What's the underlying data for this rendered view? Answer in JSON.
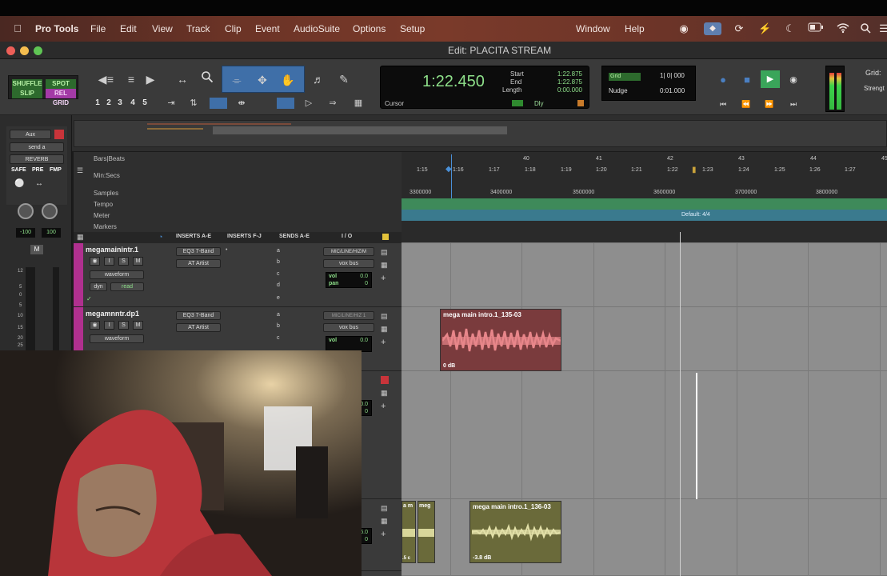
{
  "menubar": {
    "app_name": "Pro Tools",
    "items": [
      "File",
      "Edit",
      "View",
      "Track",
      "Clip",
      "Event",
      "AudioSuite",
      "Options",
      "Setup"
    ],
    "right_items": [
      "Window",
      "Help"
    ],
    "status_icons": [
      "apple-icon",
      "accessibility-icon",
      "vpn-icon",
      "sync-icon",
      "bolt-icon",
      "moon-icon",
      "battery-icon",
      "wifi-icon",
      "search-icon",
      "control-center-icon"
    ]
  },
  "window": {
    "title": "Edit: PLACITA STREAM"
  },
  "toolbar": {
    "modes": [
      "SHUFFLE",
      "SPOT",
      "SLIP",
      "REL GRID"
    ],
    "zoom_presets": [
      "1",
      "2",
      "3",
      "4",
      "5"
    ],
    "counter": {
      "main": "1:22.450",
      "start_label": "Start",
      "start": "1:22.875",
      "end_label": "End",
      "end": "1:22.875",
      "length_label": "Length",
      "length": "0:00.000",
      "cursor_label": "Cursor",
      "dly_label": "Dly"
    },
    "grid": {
      "label": "Grid",
      "value": "1| 0| 000",
      "nudge_label": "Nudge",
      "nudge_value": "0:01.000"
    },
    "grid_right_label": "Grid:",
    "strength_label": "Strengt"
  },
  "strip": {
    "aux_label": "Aux",
    "send_label": "send a",
    "reverb_label": "REVERB",
    "safe": "SAFE",
    "pre": "PRE",
    "fmp": "FMP",
    "pan_left": "-100",
    "pan_right": "100",
    "m": "M",
    "scale": [
      "12",
      "5",
      "0",
      "5",
      "10",
      "15",
      "20",
      "25"
    ]
  },
  "rulers": {
    "labels": [
      "Bars|Beats",
      "Min:Secs",
      "Samples",
      "Tempo",
      "Meter",
      "Markers"
    ],
    "bars": [
      "40",
      "41",
      "42",
      "43",
      "44",
      "45"
    ],
    "minsecs": [
      "1:15",
      "1:16",
      "1:17",
      "1:18",
      "1:19",
      "1:20",
      "1:21",
      "1:22",
      "1:23",
      "1:24",
      "1:25",
      "1:26",
      "1:27"
    ],
    "samples": [
      "3300000",
      "3400000",
      "3500000",
      "3600000",
      "3700000",
      "3800000"
    ],
    "meter_label": "Default: 4/4"
  },
  "columns": [
    "INSERTS A-E",
    "INSERTS F-J",
    "SENDS A-E",
    "I / O"
  ],
  "tracks": [
    {
      "name": "megamainintr.1",
      "inserts": [
        "EQ3 7-Band",
        "AT Artist"
      ],
      "sends": [
        "a",
        "b",
        "c",
        "d",
        "e"
      ],
      "input": "MIC/LINE/HIZ/M",
      "output": "vox bus",
      "view": "waveform",
      "dyn": "dyn",
      "auto": "read",
      "vol_label": "vol",
      "vol": "0.0",
      "pan_label": "pan",
      "pan": "0"
    },
    {
      "name": "megamnntr.dp1",
      "inserts": [
        "EQ3 7-Band",
        "AT Artist"
      ],
      "sends": [
        "a",
        "b",
        "c"
      ],
      "input": "MIC/LINE/HIZ 1",
      "output": "vox bus",
      "view": "waveform",
      "vol_label": "vol",
      "vol": "0.0"
    }
  ],
  "clips": [
    {
      "name": "mega main intro.1_135-03",
      "gain": "0 dB"
    },
    {
      "name": "mega main intro.1_136-03",
      "gain": "-3.8 dB"
    },
    {
      "name": "a m",
      "gain": ".5 c"
    },
    {
      "name": "meg",
      "gain": ""
    }
  ],
  "partial": {
    "vol": "0.0",
    "pan": "0",
    "lower_a": "6.0",
    "lower_b": "0"
  },
  "colors": {
    "clip_red": "#7a3b3d",
    "clip_olive": "#6a6a3a",
    "track_purple": "#b0308f",
    "counter_green": "#8ee08a",
    "playhead": "#c9a23a"
  }
}
